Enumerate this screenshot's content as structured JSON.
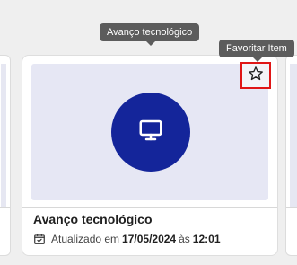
{
  "card": {
    "title": "Avanço tecnológico",
    "updated_prefix": "Atualizado em",
    "updated_date": "17/05/2024",
    "updated_join": "às",
    "updated_time": "12:01",
    "thumbnail_icon": "monitor-icon"
  },
  "tooltips": {
    "title": "Avanço tecnológico",
    "favorite": "Favoritar Item"
  },
  "favorite_button": {
    "icon": "star-outline-icon"
  },
  "colors": {
    "accent": "#14259a",
    "thumb_bg": "#e6e7f4",
    "highlight": "#e01616",
    "tooltip_bg": "#5c5c5c"
  }
}
